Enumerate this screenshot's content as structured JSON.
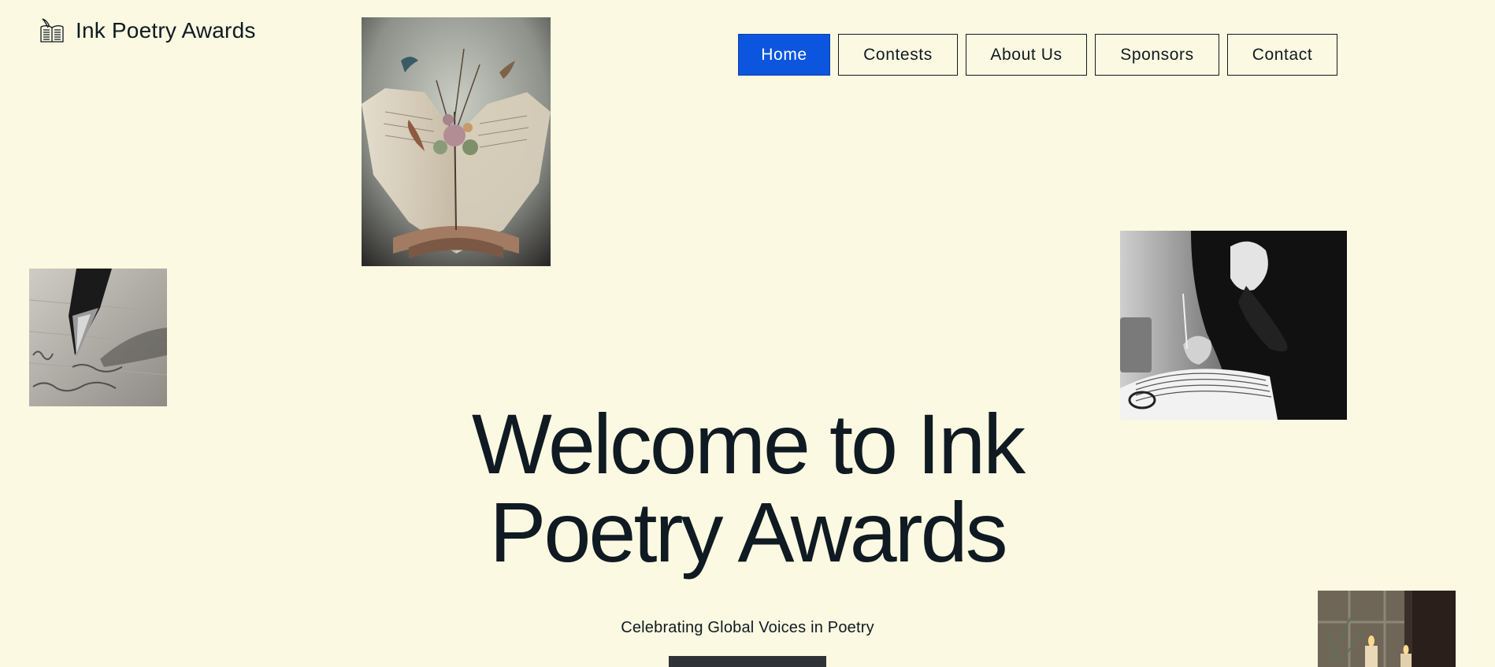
{
  "site": {
    "name": "Ink Poetry Awards",
    "logo_icon": "book-quill-icon"
  },
  "nav": {
    "items": [
      {
        "label": "Home",
        "active": true
      },
      {
        "label": "Contests",
        "active": false
      },
      {
        "label": "About Us",
        "active": false
      },
      {
        "label": "Sponsors",
        "active": false
      },
      {
        "label": "Contact",
        "active": false
      }
    ]
  },
  "hero": {
    "title": "Welcome to Ink Poetry Awards",
    "subtitle": "Celebrating Global Voices in Poetry",
    "cta_label": ""
  },
  "images": {
    "book": "open-book-flowers-photo",
    "pen": "fountain-pen-photo",
    "writer": "person-writing-notebook-photo",
    "candle": "candles-window-photo"
  },
  "colors": {
    "background": "#fbf9e1",
    "text": "#0f1a22",
    "accent": "#0c55de",
    "button_dark": "#2f3237"
  }
}
